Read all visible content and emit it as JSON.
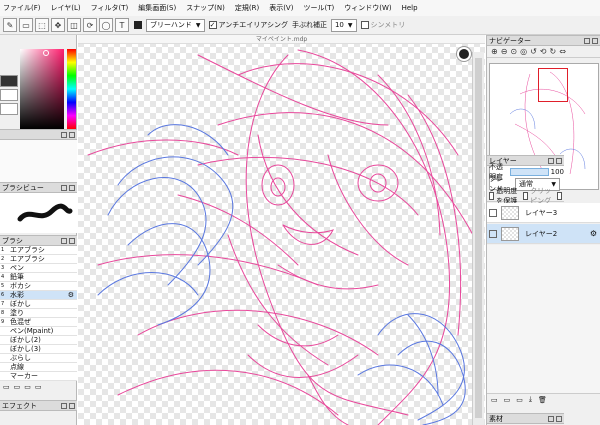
{
  "menu": [
    "ファイル(F)",
    "レイヤ(L)",
    "フィルタ(T)",
    "編集画面(S)",
    "スナップ(N)",
    "定規(R)",
    "表示(V)",
    "ツール(T)",
    "ウィンドウ(W)",
    "Help"
  ],
  "toolbar": {
    "mode_select": "ブリーハンド",
    "antialias_label": "アンチエイリアシング",
    "stabilizer_label": "手ぶれ補正",
    "stabilizer_value": "10",
    "pressure_label": "シンメトリ"
  },
  "canvas": {
    "title": "マイペイント.mdp"
  },
  "color_panel": {
    "fg_color": "#333333",
    "bg_color": "#ffffff",
    "hue_color": "#ff1d6e"
  },
  "brush_panel": {
    "title": "ブラシ",
    "items": [
      "エアブラシ",
      "エアブラシ",
      "ペン",
      "鉛筆",
      "ボカシ",
      "水彩",
      "ぼかし",
      "塗り",
      "色混ぜ",
      "ペン(Mpaint)",
      "ぼかし(2)",
      "ぼかし(3)",
      "ぶらし",
      "点線",
      "マーカー"
    ],
    "selected_index": 5
  },
  "brush_preview_label": "ブラシビュー",
  "effect_panel": {
    "title": "エフェクト"
  },
  "navigator": {
    "title": "ナビゲーター"
  },
  "layers": {
    "title": "レイヤー",
    "opacity_label": "不透明度",
    "opacity_value": "100",
    "blend_label": "ブレンド",
    "blend_value": "通常",
    "protect_label": "透明度を保護",
    "clipping_label": "クリッピング",
    "lock_label": "ロック",
    "items": [
      {
        "name": "レイヤー3",
        "selected": false
      },
      {
        "name": "レイヤー2",
        "selected": true
      }
    ]
  },
  "bottom_right_title": "素材"
}
